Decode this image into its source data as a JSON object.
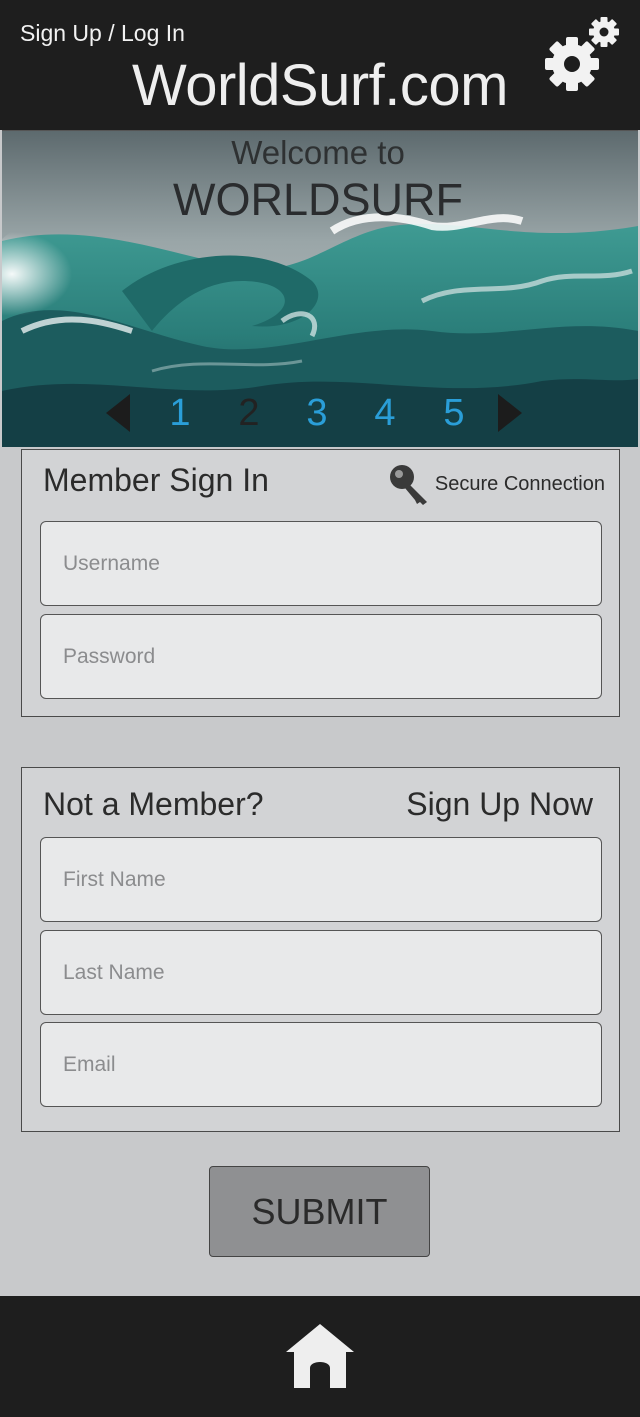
{
  "header": {
    "signup_login": "Sign Up / Log In",
    "site_title": "WorldSurf.com",
    "settings_icon": "gear-icon"
  },
  "hero": {
    "welcome": "Welcome to",
    "brand": "WORLDSURF",
    "image": "ocean-wave",
    "carousel": {
      "pages": [
        "1",
        "2",
        "3",
        "4",
        "5"
      ],
      "active_page": "2",
      "active_color": "#222222",
      "inactive_color": "#2a9ed8"
    }
  },
  "signin": {
    "title": "Member Sign In",
    "secure_label": "Secure Connection",
    "secure_icon": "key-icon",
    "username_placeholder": "Username",
    "password_placeholder": "Password"
  },
  "signup": {
    "title": "Not a Member?",
    "cta": "Sign Up Now",
    "first_name_placeholder": "First Name",
    "last_name_placeholder": "Last Name",
    "email_placeholder": "Email"
  },
  "submit_label": "SUBMIT",
  "footer": {
    "home_icon": "home-icon"
  },
  "colors": {
    "header_bg": "#1e1e1e",
    "page_bg": "#c8c9cb",
    "panel_bg": "#d2d3d5",
    "field_bg": "#e8e9ea",
    "submit_bg": "#8f9092"
  }
}
